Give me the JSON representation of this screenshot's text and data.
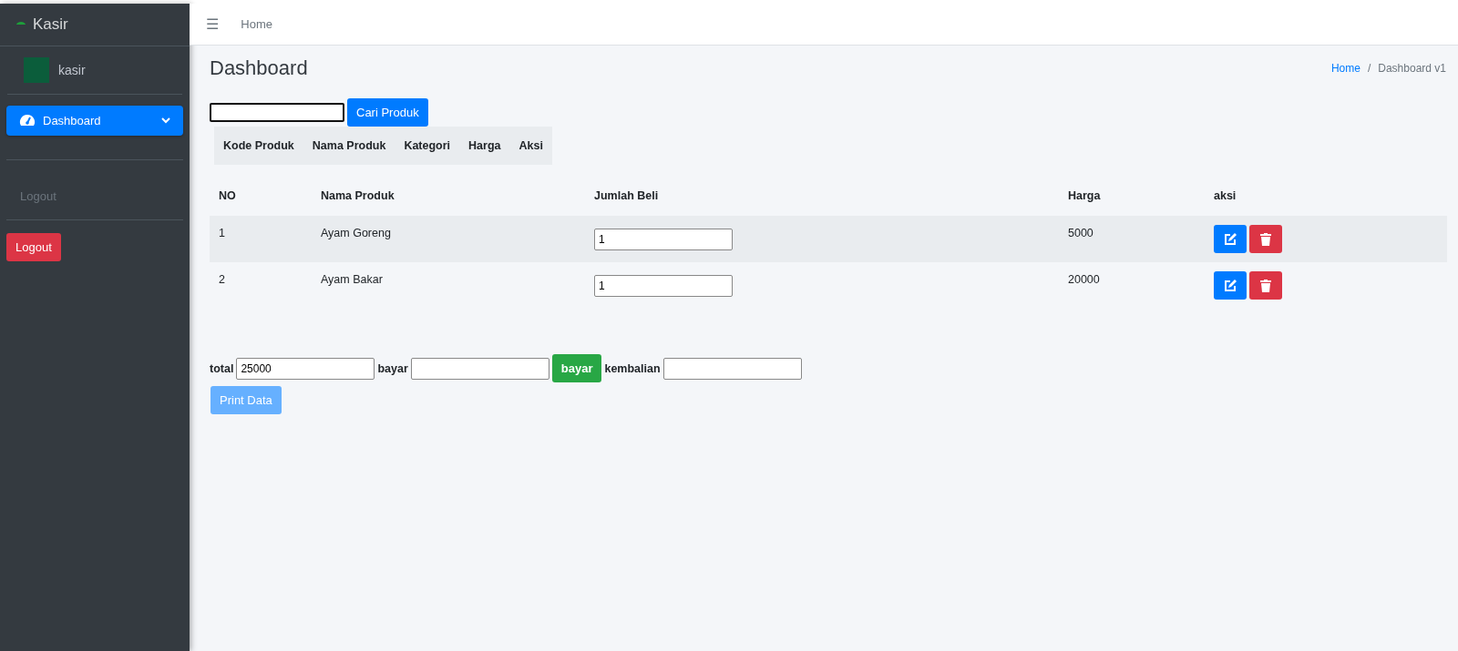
{
  "sidebar": {
    "brand": "Kasir",
    "user": "kasir",
    "menu": [
      {
        "label": "Dashboard",
        "selected": true,
        "expanded": false
      }
    ],
    "logout_link": "Logout",
    "logout_button": "Logout"
  },
  "navbar": {
    "menu_icon": "☰",
    "links": [
      "Home"
    ]
  },
  "content": {
    "title": "Dashboard",
    "breadcrumb": [
      {
        "label": "Home",
        "link": true
      },
      {
        "label": "Dashboard v1",
        "link": false
      }
    ],
    "breadcrumb_separator": "/",
    "search": {
      "button": "Cari Produk"
    },
    "product_table": {
      "columns": [
        "Kode Produk",
        "Nama Produk",
        "Kategori",
        "Harga",
        "Aksi"
      ]
    },
    "cart_table": {
      "columns": [
        "NO",
        "Nama Produk",
        "Jumlah Beli",
        "Harga",
        "aksi"
      ],
      "rows": [
        {
          "no": "1",
          "name": "Ayam Goreng",
          "qty": "1",
          "price": "5000"
        },
        {
          "no": "2",
          "name": "Ayam Bakar",
          "qty": "1",
          "price": "20000"
        }
      ]
    },
    "payment": {
      "total_label": "total",
      "total": "25000",
      "pay_label": "bayar",
      "pay_button": "bayar",
      "change_label": "kembalian",
      "print_button": "Print Data",
      "print_disabled": true
    }
  }
}
